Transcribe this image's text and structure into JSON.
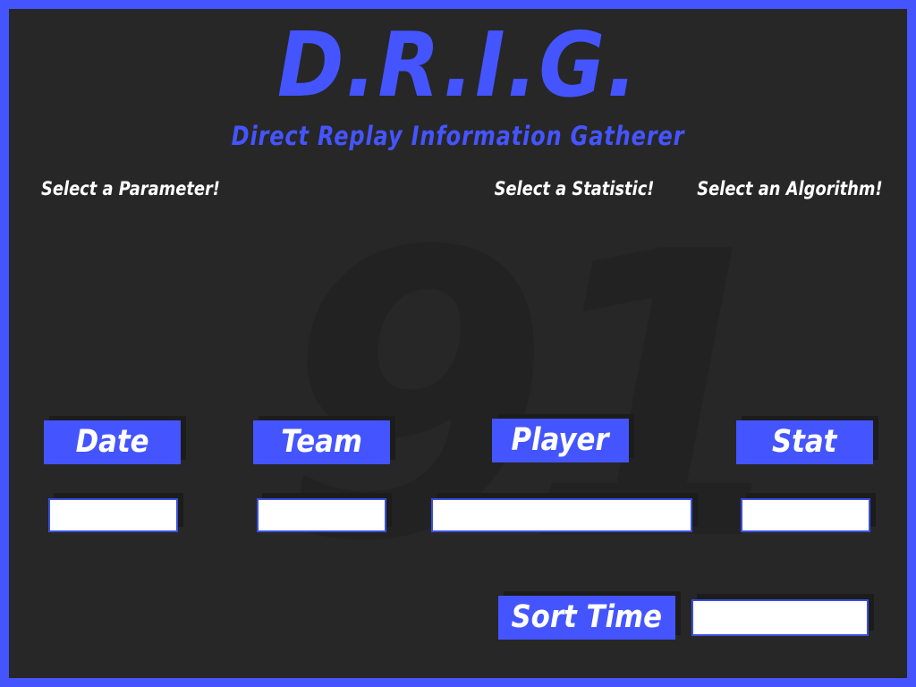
{
  "header": {
    "title": "D.R.I.G.",
    "subtitle": "Direct Replay Information Gatherer"
  },
  "watermark": "91",
  "prompts": {
    "parameter": "Select a Parameter!",
    "statistic": "Select a Statistic!",
    "algorithm": "Select an Algorithm!"
  },
  "fields": {
    "date": {
      "label": "Date",
      "value": ""
    },
    "team": {
      "label": "Team",
      "value": ""
    },
    "player": {
      "label": "Player",
      "value": ""
    },
    "stat": {
      "label": "Stat",
      "value": ""
    },
    "sort_time": {
      "label": "Sort Time",
      "value": ""
    }
  },
  "colors": {
    "accent": "#4455ff",
    "background": "#272727",
    "field": "#ffffff"
  }
}
